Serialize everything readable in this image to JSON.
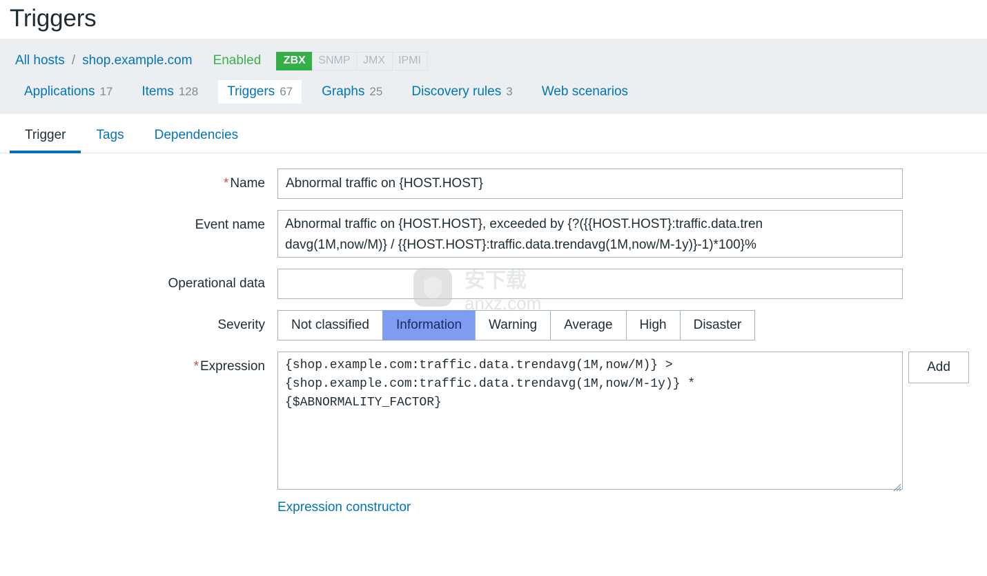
{
  "header": {
    "page_title": "Triggers"
  },
  "hostbar": {
    "breadcrumb": {
      "all_hosts": "All hosts",
      "separator": "/",
      "host": "shop.example.com"
    },
    "status": "Enabled",
    "interfaces": [
      {
        "label": "ZBX",
        "active": true
      },
      {
        "label": "SNMP",
        "active": false
      },
      {
        "label": "JMX",
        "active": false
      },
      {
        "label": "IPMI",
        "active": false
      }
    ],
    "objects": [
      {
        "label": "Applications",
        "count": "17",
        "selected": false
      },
      {
        "label": "Items",
        "count": "128",
        "selected": false
      },
      {
        "label": "Triggers",
        "count": "67",
        "selected": true
      },
      {
        "label": "Graphs",
        "count": "25",
        "selected": false
      },
      {
        "label": "Discovery rules",
        "count": "3",
        "selected": false
      },
      {
        "label": "Web scenarios",
        "count": "",
        "selected": false
      }
    ]
  },
  "form_tabs": [
    {
      "label": "Trigger",
      "active": true
    },
    {
      "label": "Tags",
      "active": false
    },
    {
      "label": "Dependencies",
      "active": false
    }
  ],
  "form": {
    "name": {
      "label": "Name",
      "required": "*",
      "value": "Abnormal traffic on {HOST.HOST}",
      "placeholder": ""
    },
    "event_name": {
      "label": "Event name",
      "required": "",
      "value": "Abnormal traffic on {HOST.HOST}, exceeded by {?({{HOST.HOST}:traffic.data.tren\ndavg(1M,now/M)} / {{HOST.HOST}:traffic.data.trendavg(1M,now/M-1y)}-1)*100}%",
      "placeholder": ""
    },
    "operational_data": {
      "label": "Operational data",
      "required": "",
      "value": "",
      "placeholder": ""
    },
    "severity": {
      "label": "Severity",
      "options": [
        {
          "label": "Not classified",
          "selected": false
        },
        {
          "label": "Information",
          "selected": true
        },
        {
          "label": "Warning",
          "selected": false
        },
        {
          "label": "Average",
          "selected": false
        },
        {
          "label": "High",
          "selected": false
        },
        {
          "label": "Disaster",
          "selected": false
        }
      ],
      "selected_value": "Information"
    },
    "expression": {
      "label": "Expression",
      "required": "*",
      "value": "{shop.example.com:traffic.data.trendavg(1M,now/M)} >\n{shop.example.com:traffic.data.trendavg(1M,now/M-1y)} *\n{$ABNORMALITY_FACTOR}",
      "placeholder": "",
      "add_button": "Add",
      "constructor_link": "Expression constructor"
    }
  },
  "colors": {
    "link": "#0275b8",
    "enabled_green": "#3db04a",
    "zbx_badge": "#34af4a",
    "severity_selected": "#7e9df0",
    "required_star": "#d14b4b",
    "panel_grey": "#ebeff2",
    "border": "#a3b3bd"
  },
  "watermark": {
    "text": "anxz.com",
    "cjk": "安下载"
  }
}
